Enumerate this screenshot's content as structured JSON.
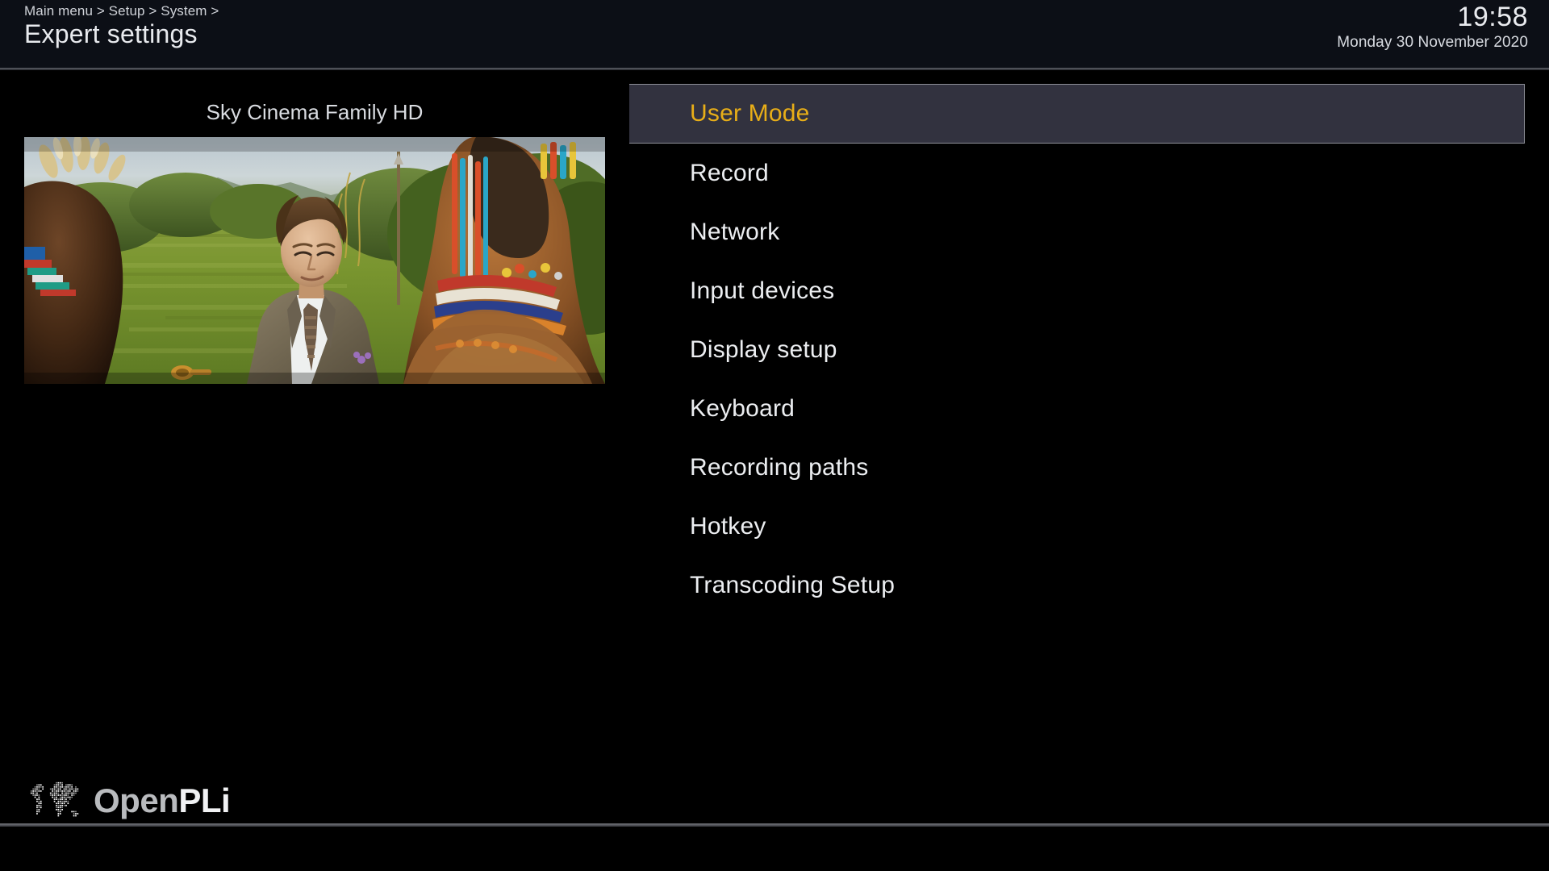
{
  "header": {
    "breadcrumb": "Main menu > Setup > System >",
    "title": "Expert settings",
    "clock_time": "19:58",
    "clock_date": "Monday 30 November 2020"
  },
  "preview": {
    "channel_name": "Sky Cinema Family HD"
  },
  "menu": {
    "items": [
      {
        "label": "User Mode",
        "selected": true
      },
      {
        "label": "Record",
        "selected": false
      },
      {
        "label": "Network",
        "selected": false
      },
      {
        "label": "Input devices",
        "selected": false
      },
      {
        "label": "Display setup",
        "selected": false
      },
      {
        "label": "Keyboard",
        "selected": false
      },
      {
        "label": "Recording paths",
        "selected": false
      },
      {
        "label": "Hotkey",
        "selected": false
      },
      {
        "label": "Transcoding Setup",
        "selected": false
      }
    ]
  },
  "footer": {
    "logo_part1": "Open",
    "logo_part2": "PLi",
    "logo_icon": "dotted-world-map-icon"
  },
  "colors": {
    "header_background": "#0c0f16",
    "page_background": "#000000",
    "selection_background": "#32323f",
    "selection_border": "#8d8f97",
    "selection_text": "#e8ae18",
    "item_text": "#eceef1",
    "breadcrumb_text": "#cfd2d8",
    "divider": "#74767c"
  }
}
